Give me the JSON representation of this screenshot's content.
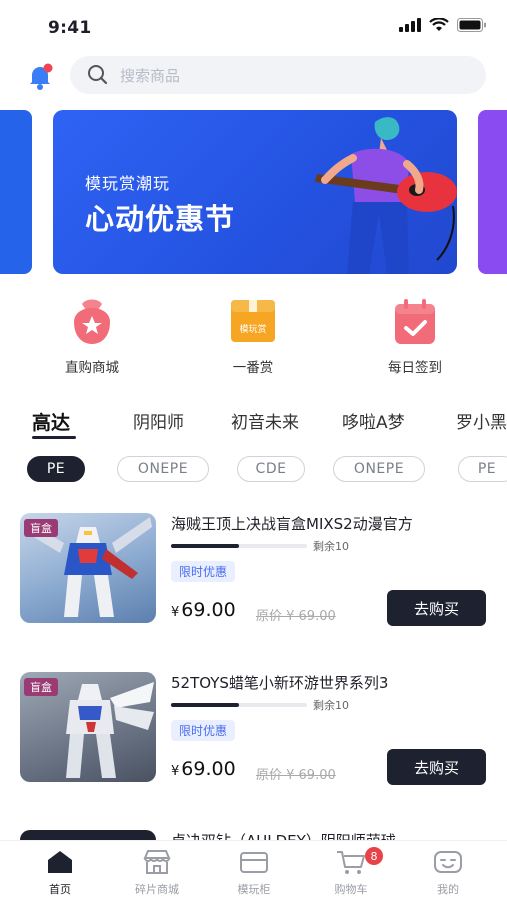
{
  "status_bar": {
    "time": "9:41"
  },
  "search": {
    "placeholder": "搜索商品"
  },
  "banner": {
    "subtitle": "模玩赏潮玩",
    "title": "心动优惠节"
  },
  "quick_links": [
    {
      "label": "直购商城",
      "icon": "bag-star-icon"
    },
    {
      "label": "一番赏",
      "icon": "box-icon",
      "icon_text": "模玩赏"
    },
    {
      "label": "每日签到",
      "icon": "calendar-check-icon"
    }
  ],
  "categories": [
    "高达",
    "阴阳师",
    "初音未来",
    "哆啦A梦",
    "罗小黑"
  ],
  "chips": [
    "PE",
    "ONEPE",
    "CDE",
    "ONEPE",
    "PE"
  ],
  "products": [
    {
      "tag": "盲盒",
      "title": "海贼王顶上决战盲盒MIXS2动漫官方",
      "progress": 0.5,
      "remain": "剩余10",
      "promo": "限时优惠",
      "currency": "¥",
      "price": "69.00",
      "orig": "原价 ¥ 69.00",
      "buy": "去购买"
    },
    {
      "tag": "盲盒",
      "title": "52TOYS蜡笔小新环游世界系列3",
      "progress": 0.5,
      "remain": "剩余10",
      "promo": "限时优惠",
      "currency": "¥",
      "price": "69.00",
      "orig": "原价 ¥ 69.00",
      "buy": "去购买"
    }
  ],
  "partial_product": {
    "title": "卓决双钻（AULDEY）阴阳师萌球"
  },
  "tabbar": [
    {
      "label": "首页",
      "icon": "home-icon"
    },
    {
      "label": "碎片商城",
      "icon": "store-icon"
    },
    {
      "label": "模玩柜",
      "icon": "cabinet-icon"
    },
    {
      "label": "购物车",
      "icon": "cart-icon",
      "badge": "8"
    },
    {
      "label": "我的",
      "icon": "profile-icon"
    }
  ],
  "colors": {
    "accent": "#1e2230",
    "banner": "#2f63f4",
    "badge": "#e7424a",
    "promo": "#4a6cf0"
  }
}
